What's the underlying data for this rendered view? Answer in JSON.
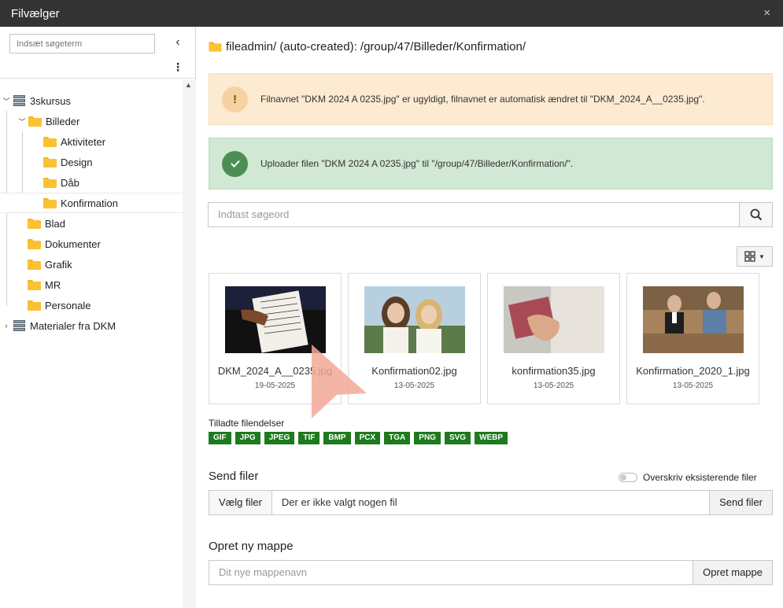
{
  "window": {
    "title": "Filvælger",
    "close": "×"
  },
  "sidebar": {
    "search_placeholder": "Indsæt søgeterm",
    "tree": [
      {
        "label": "3skursus"
      },
      {
        "label": "Billeder"
      },
      {
        "label": "Aktiviteter"
      },
      {
        "label": "Design"
      },
      {
        "label": "Dåb"
      },
      {
        "label": "Konfirmation"
      },
      {
        "label": "Blad"
      },
      {
        "label": "Dokumenter"
      },
      {
        "label": "Grafik"
      },
      {
        "label": "MR"
      },
      {
        "label": "Personale"
      },
      {
        "label": "Materialer fra DKM"
      }
    ]
  },
  "main": {
    "path": "fileadmin/ (auto-created): /group/47/Billeder/Konfirmation/",
    "warning": "Filnavnet \"DKM 2024 A  0235.jpg\" er ugyldigt, filnavnet er automatisk ændret til \"DKM_2024_A__0235.jpg\".",
    "warning_icon": "!",
    "success": "Uploader filen \"DKM 2024 A  0235.jpg\" til \"/group/47/Billeder/Konfirmation/\".",
    "search_placeholder": "Indtast søgeord",
    "files": [
      {
        "name": "DKM_2024_A__0235.jpg",
        "date": "19-05-2025"
      },
      {
        "name": "Konfirmation02.jpg",
        "date": "13-05-2025"
      },
      {
        "name": "konfirmation35.jpg",
        "date": "13-05-2025"
      },
      {
        "name": "Konfirmation_2020_1.jpg",
        "date": "13-05-2025"
      }
    ],
    "extensions_title": "Tilladte filendelser",
    "extensions": [
      "GIF",
      "JPG",
      "JPEG",
      "TIF",
      "BMP",
      "PCX",
      "TGA",
      "PNG",
      "SVG",
      "WEBP"
    ],
    "upload": {
      "title": "Send filer",
      "overwrite_label": "Overskriv eksisterende filer",
      "choose_label": "Vælg filer",
      "no_file": "Der er ikke valgt nogen fil",
      "send_label": "Send filer"
    },
    "newfolder": {
      "title": "Opret ny mappe",
      "placeholder": "Dit nye mappenavn",
      "create_label": "Opret mappe"
    }
  },
  "colors": {
    "titlebar": "#333333",
    "folder": "#fcc132",
    "ext_badge": "#1d7a1d",
    "warning_bg": "#fcebd1",
    "success_bg": "#d0e8d4"
  }
}
